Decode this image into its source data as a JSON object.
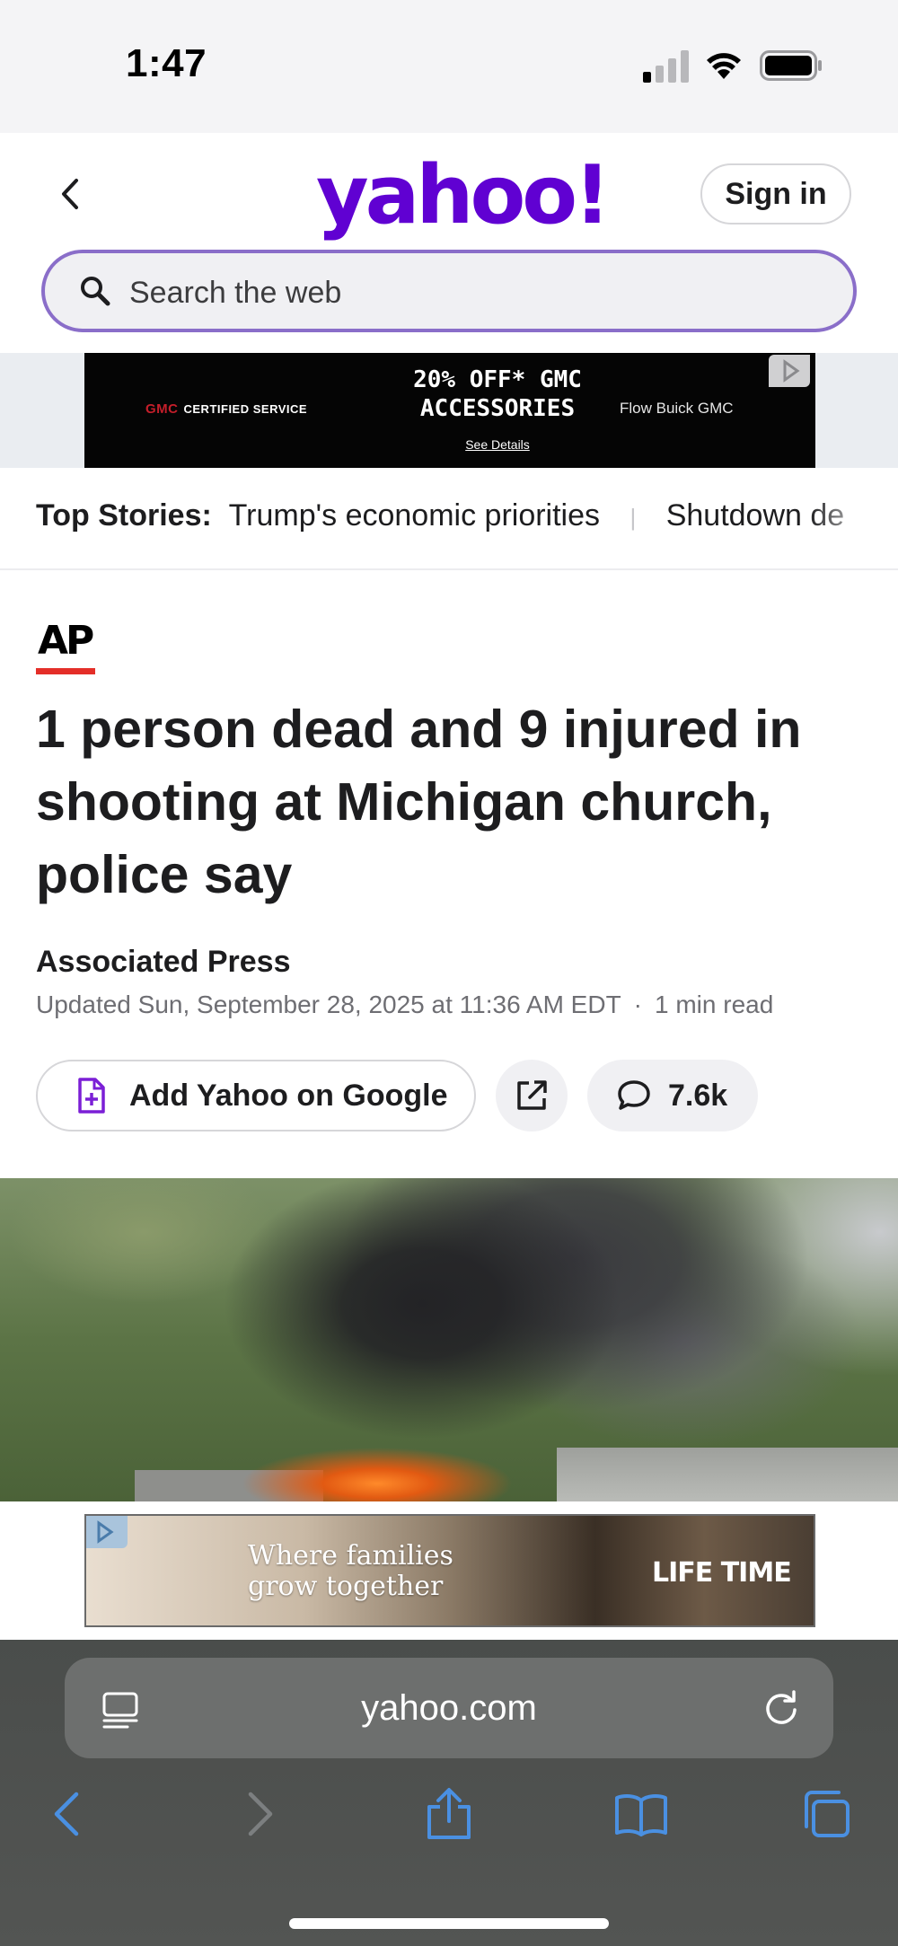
{
  "status_bar": {
    "time": "1:47"
  },
  "header": {
    "logo": "yahoo!",
    "signin_label": "Sign in",
    "search_placeholder": "Search the web"
  },
  "ad_top": {
    "brand_left": "GMC",
    "brand_left_sub": "CERTIFIED SERVICE",
    "headline_line1": "20% OFF* GMC",
    "headline_line2": "ACCESSORIES",
    "details_link": "See Details",
    "dealer": "Flow Buick GMC"
  },
  "top_stories": {
    "label": "Top Stories:",
    "items": [
      "Trump's economic priorities",
      "Shutdown de"
    ]
  },
  "article": {
    "source_logo": "AP",
    "headline": "1 person dead and 9 injured in shooting at Michigan church, police say",
    "author": "Associated Press",
    "updated": "Updated Sun, September 28, 2025 at 11:36 AM EDT",
    "read_time": "1 min read",
    "add_google_label": "Add Yahoo on Google",
    "comments_count": "7.6k"
  },
  "ad_bottom": {
    "line1": "Where families",
    "line2": "grow together",
    "brand": "LIFE TIME"
  },
  "safari": {
    "url": "yahoo.com"
  },
  "colors": {
    "brand_purple": "#6001d2",
    "search_border": "#8a6ec9",
    "ap_red": "#e42e28",
    "safari_icon_blue": "#4a90e2"
  }
}
